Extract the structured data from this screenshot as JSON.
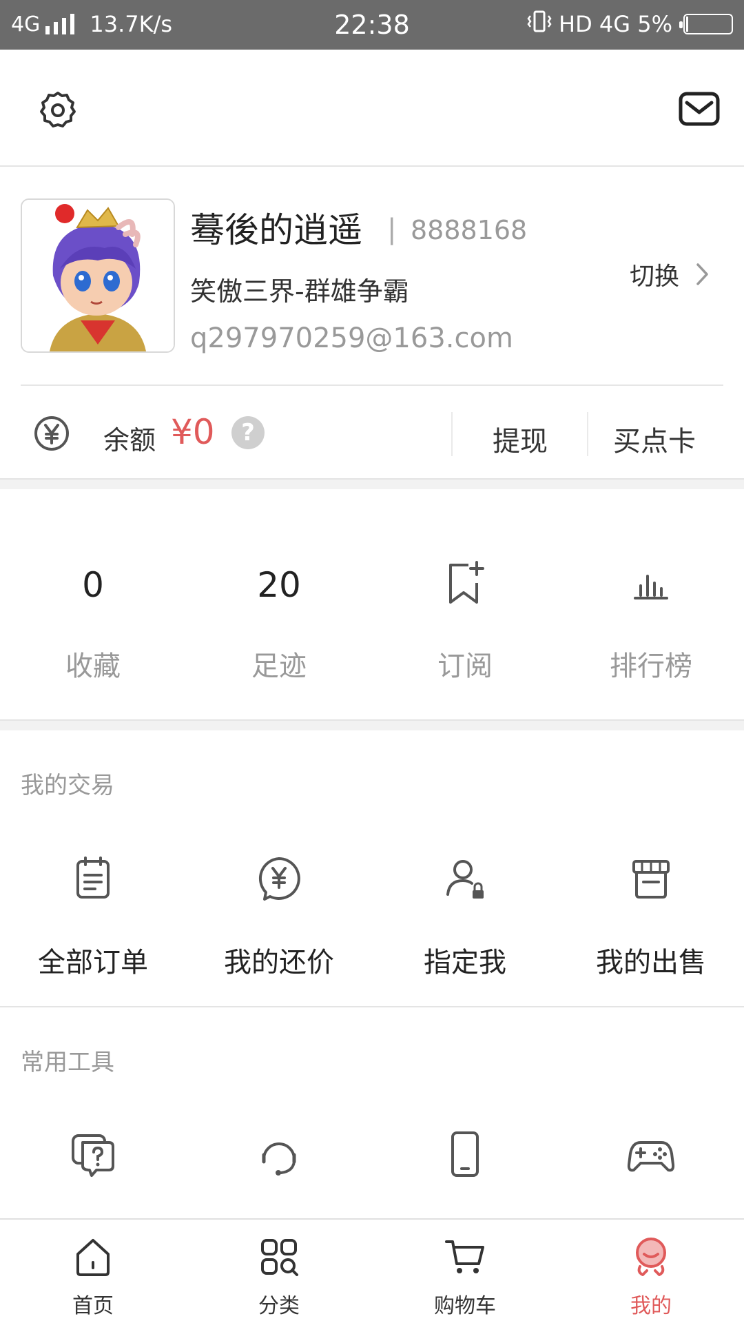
{
  "status_bar": {
    "network": "4G",
    "speed": "13.7K/s",
    "time": "22:38",
    "right_text": "HD 4G 5%",
    "battery_level": 0.05
  },
  "profile": {
    "username": "蓦後的逍遥",
    "separator": "|",
    "user_id": "8888168",
    "server": "笑傲三界-群雄争霸",
    "email": "q297970259@163.com",
    "switch_label": "切换"
  },
  "balance": {
    "label": "余额",
    "value": "¥0",
    "help": "?",
    "withdraw_label": "提现",
    "buy_card_label": "买点卡"
  },
  "stats": [
    {
      "value": "0",
      "label": "收藏"
    },
    {
      "value": "20",
      "label": "足迹"
    },
    {
      "icon": "bookmark-add-icon",
      "label": "订阅"
    },
    {
      "icon": "bar-chart-icon",
      "label": "排行榜"
    }
  ],
  "trade": {
    "title": "我的交易",
    "items": [
      {
        "icon": "order-list-icon",
        "label": "全部订单"
      },
      {
        "icon": "yen-bubble-icon",
        "label": "我的还价"
      },
      {
        "icon": "user-lock-icon",
        "label": "指定我"
      },
      {
        "icon": "store-icon",
        "label": "我的出售"
      }
    ]
  },
  "tools": {
    "title": "常用工具",
    "items": [
      {
        "icon": "faq-icon"
      },
      {
        "icon": "headset-icon"
      },
      {
        "icon": "phone-icon"
      },
      {
        "icon": "gamepad-icon"
      }
    ]
  },
  "nav": {
    "items": [
      {
        "icon": "home-icon",
        "label": "首页"
      },
      {
        "icon": "category-icon",
        "label": "分类"
      },
      {
        "icon": "cart-icon",
        "label": "购物车"
      },
      {
        "icon": "profile-icon",
        "label": "我的",
        "active": true
      }
    ]
  },
  "colors": {
    "accent": "#e05a5a",
    "status_bar": "#6b6b6b",
    "muted_text": "#999999",
    "icon": "#555555"
  }
}
